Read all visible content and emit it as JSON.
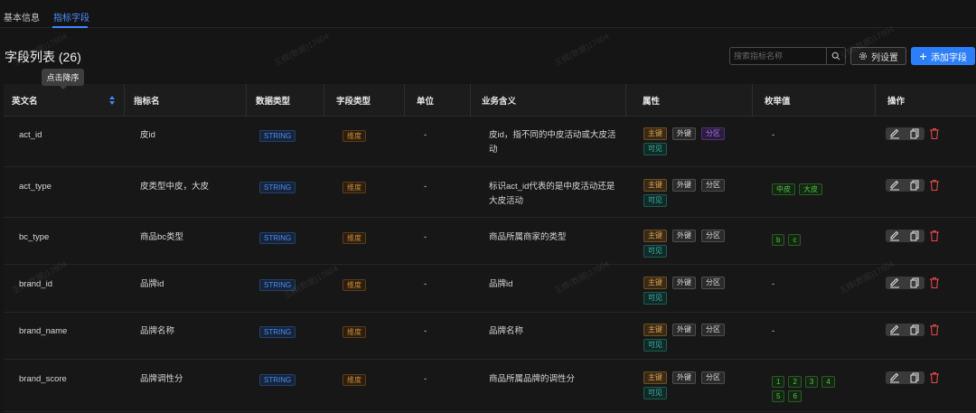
{
  "tabs": [
    {
      "label": "基本信息",
      "active": false
    },
    {
      "label": "指标字段",
      "active": true
    }
  ],
  "header": {
    "title": "字段列表 (26)",
    "search_placeholder": "搜索指标名称",
    "columns_button": "列设置",
    "add_button": "添加字段"
  },
  "tooltip": "点击降序",
  "columns": [
    "英文名",
    "指标名",
    "数据类型",
    "字段类型",
    "单位",
    "业务含义",
    "属性",
    "枚举值",
    "操作"
  ],
  "rows": [
    {
      "en": "act_id",
      "name": "皮id",
      "dtype": "STRING",
      "ftype": "维度",
      "unit": "-",
      "meaning": "皮id，指不同的中皮活动或大皮活动",
      "enums": [],
      "enum_text": "-",
      "partition_highlight": true
    },
    {
      "en": "act_type",
      "name": "皮类型中皮，大皮",
      "dtype": "STRING",
      "ftype": "维度",
      "unit": "-",
      "meaning": "标识act_id代表的是中皮活动还是大皮活动",
      "enums": [
        "中皮",
        "大皮"
      ],
      "enum_text": "",
      "partition_highlight": false
    },
    {
      "en": "bc_type",
      "name": "商品bc类型",
      "dtype": "STRING",
      "ftype": "维度",
      "unit": "-",
      "meaning": "商品所属商家的类型",
      "enums": [
        "b",
        "c"
      ],
      "enum_text": "",
      "partition_highlight": false
    },
    {
      "en": "brand_id",
      "name": "品牌id",
      "dtype": "STRING",
      "ftype": "维度",
      "unit": "-",
      "meaning": "品牌id",
      "enums": [],
      "enum_text": "-",
      "partition_highlight": false
    },
    {
      "en": "brand_name",
      "name": "品牌名称",
      "dtype": "STRING",
      "ftype": "维度",
      "unit": "-",
      "meaning": "品牌名称",
      "enums": [],
      "enum_text": "-",
      "partition_highlight": false
    },
    {
      "en": "brand_score",
      "name": "品牌调性分",
      "dtype": "STRING",
      "ftype": "维度",
      "unit": "-",
      "meaning": "商品所属品牌的调性分",
      "enums": [
        "1",
        "2",
        "3",
        "4",
        "5",
        "6"
      ],
      "enum_text": "",
      "partition_highlight": false
    }
  ],
  "attr_labels": {
    "pk": "主键",
    "fk": "外键",
    "part": "分区",
    "visible": "可见"
  },
  "icons": {
    "search": "search-icon",
    "columns": "gear-icon",
    "add": "plus-icon",
    "sort": "sort-icon",
    "edit": "edit-icon",
    "copy": "copy-icon",
    "delete": "trash-icon"
  },
  "colors": {
    "accent": "#2d7ff9",
    "delete": "#e5484d"
  },
  "watermark": "王辉(数据)17604"
}
